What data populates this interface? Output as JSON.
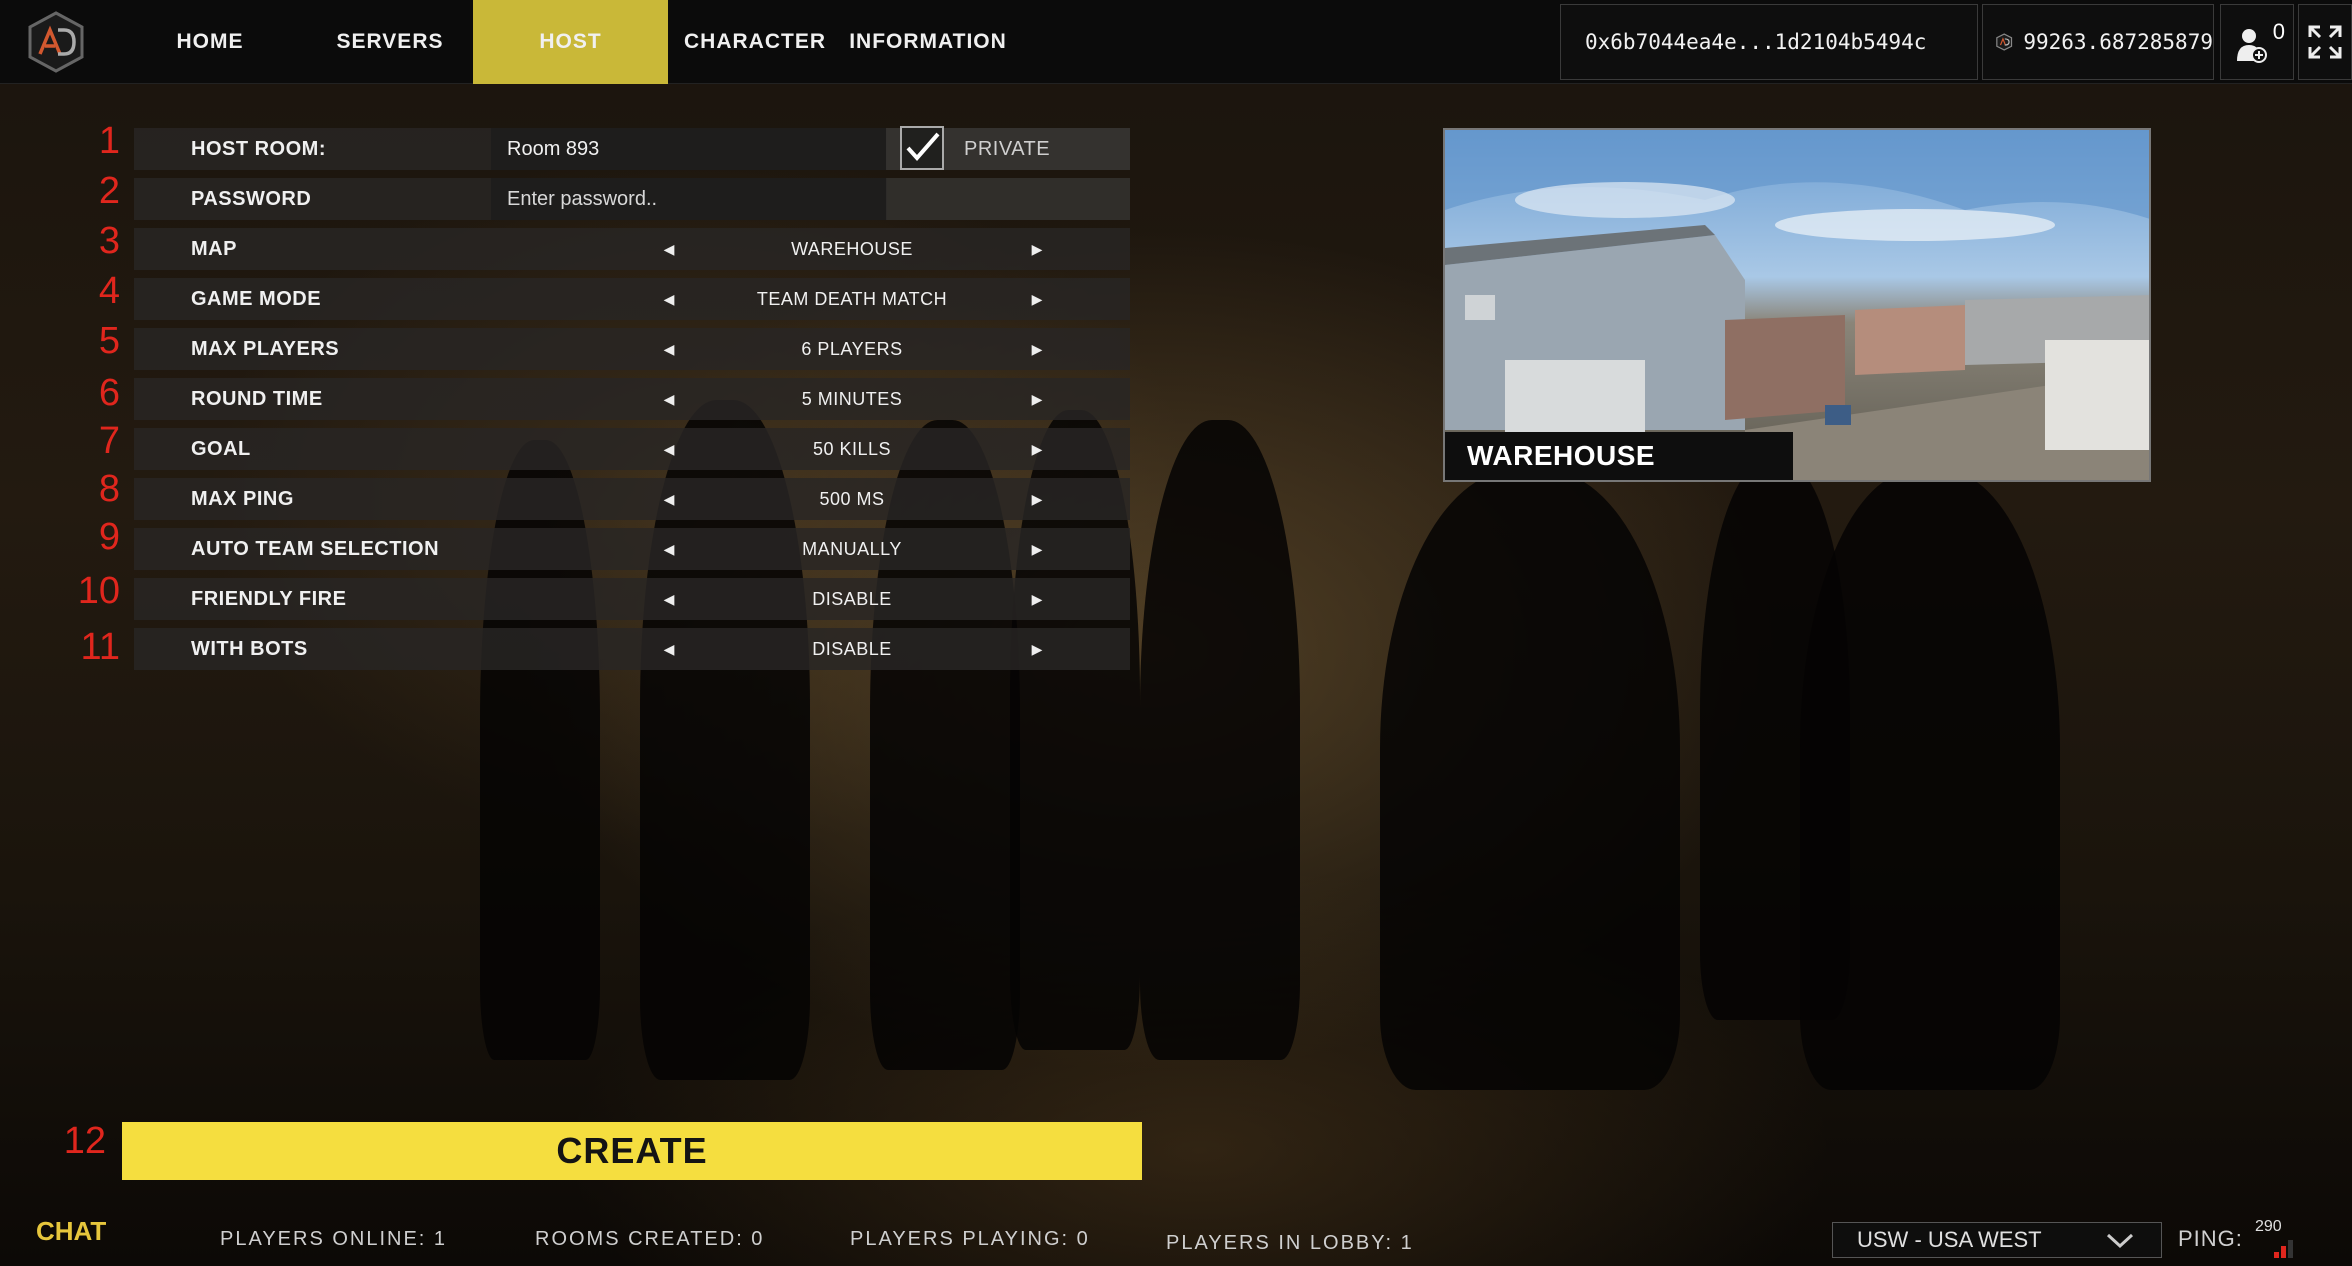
{
  "nav": {
    "items": [
      {
        "label": "HOME",
        "active": false
      },
      {
        "label": "SERVERS",
        "active": false
      },
      {
        "label": "HOST",
        "active": true
      },
      {
        "label": "CHARACTER",
        "active": false
      },
      {
        "label": "INFORMATION",
        "active": false
      }
    ],
    "wallet_address": "0x6b7044ea4e...1d2104b5494c",
    "balance": "99263.687285879",
    "friends_count": "0"
  },
  "form": {
    "host_room": {
      "num": "1",
      "label": "HOST ROOM:",
      "value": "Room 893"
    },
    "private": {
      "label": "PRIVATE",
      "checked": true
    },
    "password": {
      "num": "2",
      "label": "PASSWORD",
      "placeholder": "Enter password.."
    },
    "options": [
      {
        "num": "3",
        "label": "MAP",
        "value": "WAREHOUSE"
      },
      {
        "num": "4",
        "label": "GAME MODE",
        "value": "TEAM DEATH MATCH"
      },
      {
        "num": "5",
        "label": "MAX PLAYERS",
        "value": "6 PLAYERS"
      },
      {
        "num": "6",
        "label": "ROUND TIME",
        "value": "5 MINUTES"
      },
      {
        "num": "7",
        "label": "GOAL",
        "value": "50 KILLS"
      },
      {
        "num": "8",
        "label": "MAX PING",
        "value": "500 MS"
      },
      {
        "num": "9",
        "label": "AUTO TEAM SELECTION",
        "value": "MANUALLY"
      },
      {
        "num": "10",
        "label": "FRIENDLY FIRE",
        "value": "DISABLE"
      },
      {
        "num": "11",
        "label": "WITH BOTS",
        "value": "DISABLE"
      }
    ]
  },
  "preview": {
    "map_name": "WAREHOUSE"
  },
  "create": {
    "num": "12",
    "label": "CREATE"
  },
  "footer": {
    "chat": "CHAT",
    "players_online": "PLAYERS ONLINE: 1",
    "rooms_created": "ROOMS CREATED: 0",
    "players_playing": "PLAYERS PLAYING: 0",
    "players_in_lobby": "PLAYERS IN LOBBY: 1",
    "region": "USW - USA WEST",
    "ping_label": "PING:",
    "ping_value": "290"
  },
  "colors": {
    "accent": "#c9b838",
    "create": "#f5de3f",
    "chat": "#e6c63c",
    "row_number": "#e0261d"
  }
}
